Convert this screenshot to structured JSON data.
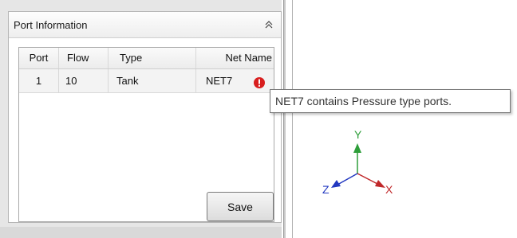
{
  "panel": {
    "title": "Port Information",
    "collapse_icon": "chevron-double-up-icon"
  },
  "grid": {
    "columns": [
      "Port",
      "Flow",
      "Type",
      "Net Name"
    ],
    "rows": [
      {
        "port": "1",
        "flow": "10",
        "type": "Tank",
        "net_name": "NET7",
        "status_icon": "error-icon"
      }
    ]
  },
  "save_label": "Save",
  "tooltip": "NET7 contains Pressure type ports.",
  "axes": {
    "y_label": "Y",
    "x_label": "X",
    "z_label": "Z",
    "colors": {
      "x": "#c0282a",
      "y": "#2e9e3a",
      "z": "#2238c0"
    }
  },
  "colors": {
    "error": "#d81e1e"
  }
}
